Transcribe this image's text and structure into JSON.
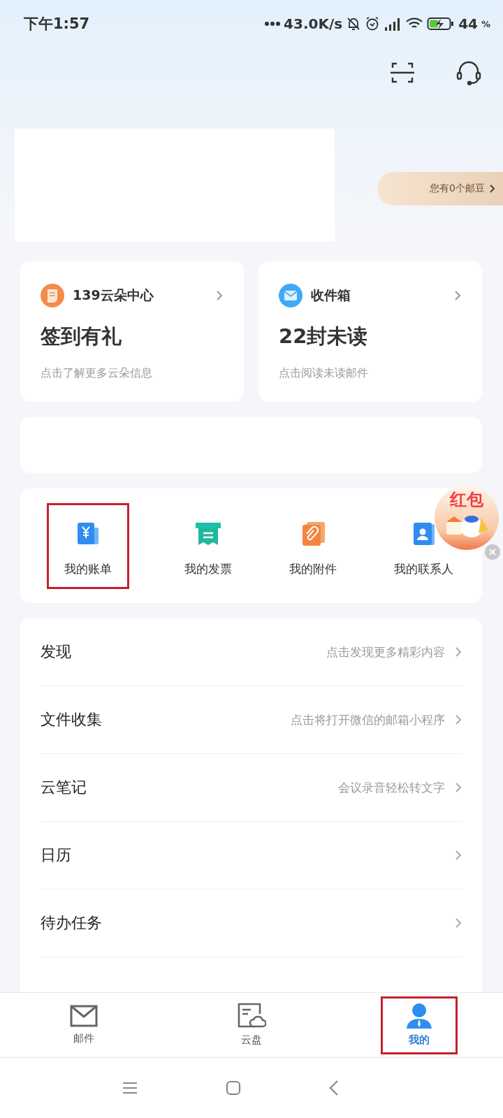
{
  "status_bar": {
    "time": "下午1:57",
    "speed": "43.0K/s",
    "battery": "44",
    "battery_unit": "%"
  },
  "header": {
    "beans": "您有0个邮豆"
  },
  "cards": [
    {
      "kind": "cloud",
      "title": "139云朵中心",
      "headline": "签到有礼",
      "hint": "点击了解更多云朵信息"
    },
    {
      "kind": "inbox",
      "title": "收件箱",
      "headline": "22封未读",
      "hint": "点击阅读未读邮件"
    }
  ],
  "shortcuts": [
    {
      "kind": "bill",
      "label": "我的账单",
      "highlighted": true
    },
    {
      "kind": "invoice",
      "label": "我的发票",
      "highlighted": false
    },
    {
      "kind": "attachment",
      "label": "我的附件",
      "highlighted": false
    },
    {
      "kind": "contacts",
      "label": "我的联系人",
      "highlighted": false
    }
  ],
  "red_packet": {
    "label": "红包"
  },
  "menu": [
    {
      "title": "发现",
      "hint": "点击发现更多精彩内容"
    },
    {
      "title": "文件收集",
      "hint": "点击将打开微信的邮箱小程序"
    },
    {
      "title": "云笔记",
      "hint": "会议录音轻松转文字"
    },
    {
      "title": "日历"
    },
    {
      "title": "待办任务"
    }
  ],
  "tabs": [
    {
      "kind": "mail",
      "label": "邮件",
      "selected": false,
      "highlighted": false
    },
    {
      "kind": "disk",
      "label": "云盘",
      "selected": false,
      "highlighted": false
    },
    {
      "kind": "me",
      "label": "我的",
      "selected": true,
      "highlighted": true
    }
  ]
}
